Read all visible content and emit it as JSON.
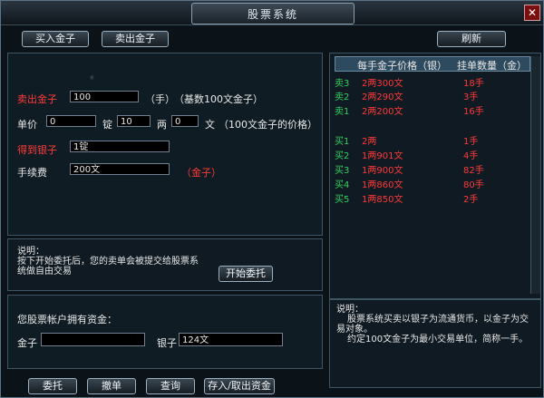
{
  "window": {
    "title": "股票系统"
  },
  "toolbar": {
    "buy_gold": "买入金子",
    "sell_gold": "卖出金子",
    "refresh": "刷新"
  },
  "form": {
    "sell_label": "卖出金子",
    "sell_value": "100",
    "sell_unit": "（手）",
    "sell_base": "（基数100文金子）",
    "price_label": "单价",
    "price_ding": "0",
    "ding_unit": "锭",
    "price_liang": "10",
    "liang_unit": "两",
    "price_wen": "0",
    "wen_unit": "文",
    "price_note": "（100文金子的价格）",
    "receive_label": "得到银子",
    "receive_value": "1锭",
    "fee_label": "手续费",
    "fee_value": "200文",
    "fee_unit": "（金子）"
  },
  "instructions": {
    "heading": "说明：",
    "line1": "按下开始委托后，您的卖单会被提交给股票系",
    "line2": "统做自由交易",
    "start_button": "开始委托"
  },
  "funds": {
    "heading": "您股票帐户拥有资金：",
    "gold_label": "金子",
    "gold_value": "",
    "silver_label": "银子",
    "silver_value": "124文"
  },
  "bottom_buttons": {
    "entrust": "委托",
    "cancel": "撤单",
    "query": "查询",
    "deposit": "存入/取出资金"
  },
  "market": {
    "col_price": "每手金子价格（银）",
    "col_qty": "挂单数量（金）",
    "sells": [
      {
        "label": "卖3",
        "price": "2两300文",
        "qty": "18手"
      },
      {
        "label": "卖2",
        "price": "2两290文",
        "qty": "3手"
      },
      {
        "label": "卖1",
        "price": "2两200文",
        "qty": "16手"
      }
    ],
    "buys": [
      {
        "label": "买1",
        "price": "2两",
        "qty": "1手"
      },
      {
        "label": "买2",
        "price": "1两901文",
        "qty": "4手"
      },
      {
        "label": "买3",
        "price": "1两900文",
        "qty": "82手"
      },
      {
        "label": "买4",
        "price": "1两860文",
        "qty": "80手"
      },
      {
        "label": "买5",
        "price": "1两850文",
        "qty": "2手"
      }
    ]
  },
  "help": {
    "heading": "说明：",
    "line1": "股票系统买卖以银子为流通货币，以金子为交",
    "line2": "易对象。",
    "line3": "约定100文金子为最小交易单位，简称一手。"
  }
}
